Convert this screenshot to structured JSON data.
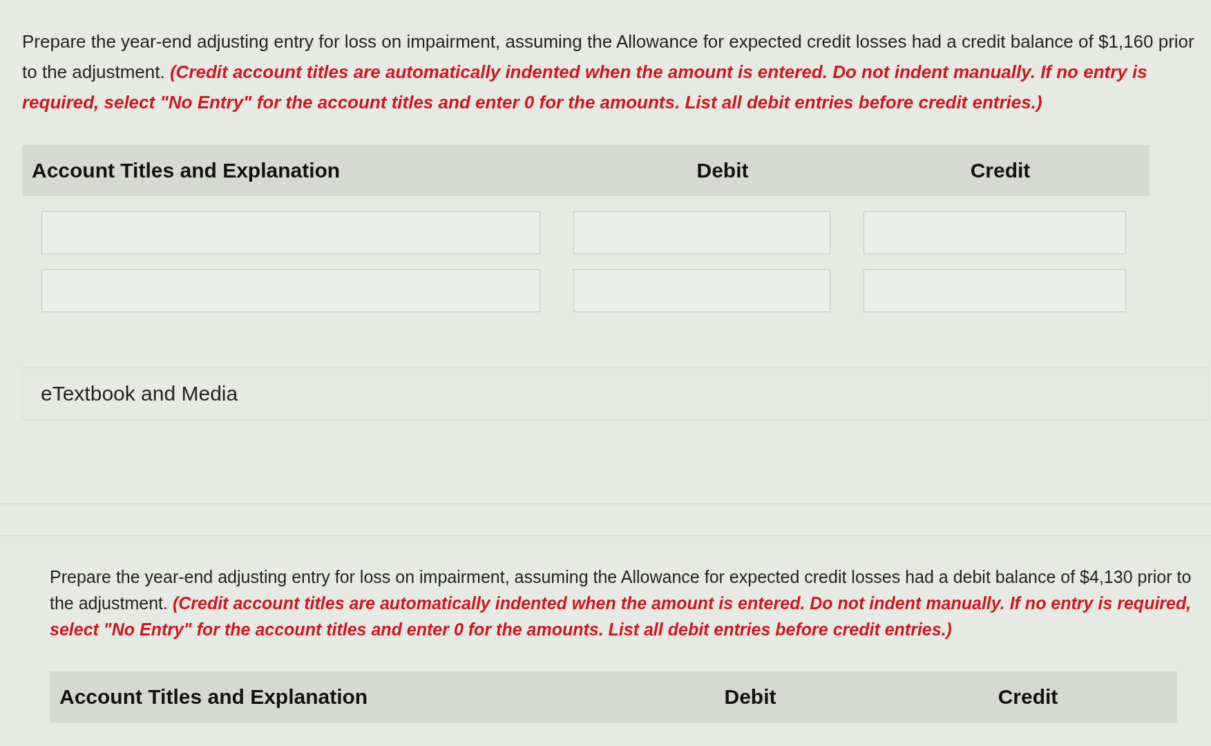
{
  "sections": [
    {
      "question": "Prepare the year-end adjusting entry for loss on impairment, assuming the Allowance for expected credit losses had a credit balance of $1,160 prior to the adjustment.",
      "instruction": "(Credit account titles are automatically indented when the amount is entered. Do not indent manually. If no entry is required, select \"No Entry\" for the account titles and enter 0 for the amounts. List all debit entries before credit entries.)",
      "columns": [
        "Account Titles and Explanation",
        "Debit",
        "Credit"
      ],
      "rows": [
        {
          "kind": "entry"
        },
        {
          "kind": "entry"
        }
      ],
      "media_link": "eTextbook and Media"
    },
    {
      "question": "Prepare the year-end adjusting entry for loss on impairment, assuming the Allowance for expected credit losses had a debit balance of $4,130 prior to the adjustment.",
      "instruction": "(Credit account titles are automatically indented when the amount is entered. Do not indent manually. If no entry is required, select \"No Entry\" for the account titles and enter 0 for the amounts. List all debit entries before credit entries.)",
      "columns": [
        "Account Titles and Explanation",
        "Debit",
        "Credit"
      ]
    }
  ]
}
